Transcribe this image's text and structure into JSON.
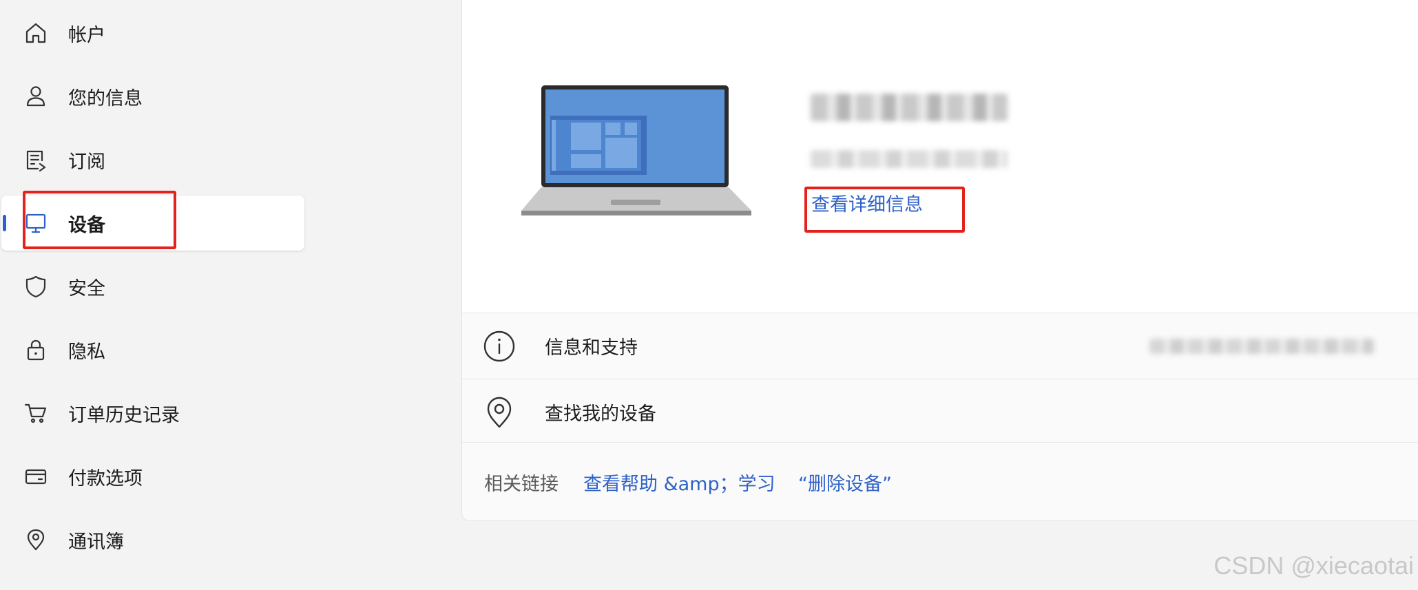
{
  "sidebar": {
    "items": [
      {
        "label": "帐户",
        "icon": "home-icon"
      },
      {
        "label": "您的信息",
        "icon": "person-icon"
      },
      {
        "label": "订阅",
        "icon": "subscription-icon"
      },
      {
        "label": "设备",
        "icon": "monitor-icon",
        "active": true
      },
      {
        "label": "安全",
        "icon": "shield-icon"
      },
      {
        "label": "隐私",
        "icon": "lock-icon"
      },
      {
        "label": "订单历史记录",
        "icon": "cart-icon"
      },
      {
        "label": "付款选项",
        "icon": "card-icon"
      },
      {
        "label": "通讯簿",
        "icon": "location-pin-icon"
      }
    ]
  },
  "device": {
    "view_details": "查看详细信息"
  },
  "rows": {
    "info_support": "信息和支持",
    "find_device": "查找我的设备"
  },
  "related": {
    "label": "相关链接",
    "help_link": "查看帮助 &amp；学习",
    "remove_link": "“删除设备”"
  },
  "watermark": "CSDN @xiecaotai",
  "colors": {
    "accent": "#2f62c8",
    "highlight": "#e4221b",
    "background": "#f3f3f3"
  }
}
